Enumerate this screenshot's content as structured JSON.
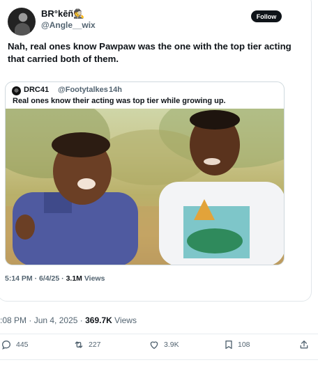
{
  "author": {
    "display_name": "BR°kēñ🕵️",
    "handle": "@Angle__wix",
    "avatar_icon": "profile-avatar"
  },
  "follow_label": "Follow",
  "tweet_text": "Nah, real ones know Pawpaw was the one with the top tier acting that carried both of them.",
  "quoted": {
    "name": "DRC41",
    "handle": "@Footytalkes",
    "separator": "·",
    "time": "14h",
    "text": "Real ones know their acting was top tier while growing up."
  },
  "inner_meta": {
    "time": "5:14 PM",
    "dot1": "·",
    "date": "6/4/25",
    "dot2": "·",
    "views_count": "3.1M",
    "views_label": "Views"
  },
  "outer_meta": {
    "time": ":08 PM",
    "dot1": "·",
    "date": "Jun 4, 2025",
    "dot2": "·",
    "views_count": "369.7K",
    "views_label": "Views"
  },
  "actions": {
    "replies": "445",
    "reposts": "227",
    "likes": "3.9K",
    "bookmarks": "108"
  },
  "colors": {
    "text_primary": "#0f1419",
    "text_secondary": "#536471",
    "border": "#cfd9de",
    "follow_bg": "#0f1419"
  }
}
